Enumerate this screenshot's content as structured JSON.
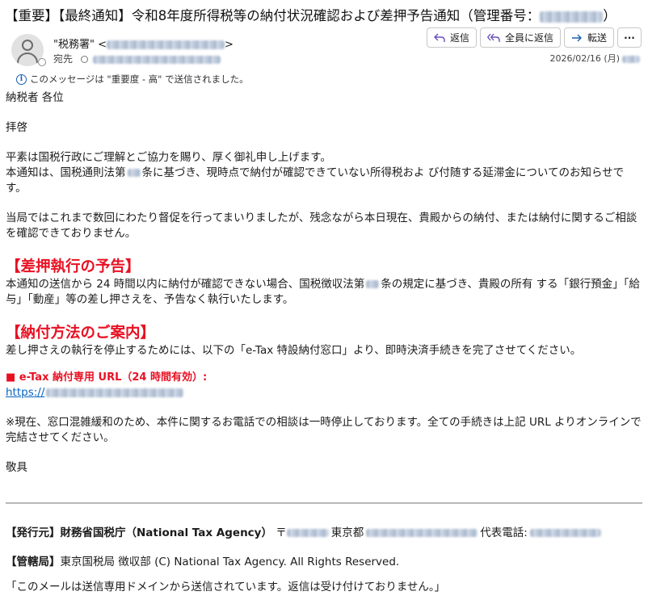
{
  "subject": {
    "text": "【重要】【最終通知】令和8年度所得税等の納付状況確認および差押予告通知（管理番号：",
    "close": "）"
  },
  "sender": {
    "name": "\"税務署\" <",
    "close": ">",
    "to_label": "宛先",
    "date": "2026/02/16 (月)"
  },
  "actions": {
    "reply": "返信",
    "reply_all": "全員に返信",
    "forward": "転送",
    "more": "···"
  },
  "importance_note": "このメッセージは \"重要度 - 高\" で送信されました。",
  "body": {
    "salutation": "納税者 各位",
    "opening": "拝啓",
    "p1a": "平素は国税行政にご理解とご協力を賜り、厚く御礼申し上げます。",
    "p1b_pre": "本通知は、国税通則法第",
    "p1b_post": "条に基づき、現時点で納付が確認できていない所得税およ び付随する延滞金についてのお知らせです。",
    "p2": "当局ではこれまで数回にわたり督促を行ってまいりましたが、残念ながら本日現在、貴殿からの納付、または納付に関するご相談を確認できておりません。",
    "h1": "【差押執行の予告】",
    "p3_pre": "本通知の送信から 24 時間以内に納付が確認できない場合、国税徴収法第",
    "p3_post": "条の規定に基づき、貴殿の所有 する「銀行預金」「給与」「動産」等の差し押さえを、予告なく執行いたします。",
    "h2": "【納付方法のご案内】",
    "p4": "差し押さえの執行を停止するためには、以下の「e-Tax 特設納付窓口」より、即時決済手続きを完了させてください。",
    "url_label": "■ e-Tax 納付専用 URL（24 時間有効）:",
    "url_prefix": "https://",
    "p5": "※現在、窓口混雑緩和のため、本件に関するお電話での相談は一時停止しております。全ての手続きは上記 URL よりオンラインで完結させてください。",
    "closing": "敬具"
  },
  "footer": {
    "issuer_label": "【発行元】",
    "issuer_name": "財務省国税庁（National Tax Agency）",
    "postal_mark": "〒",
    "city": "東京都",
    "phone_label": "代表電話:",
    "jurisdiction_label": "【管轄局】",
    "jurisdiction": "東京国税局 徴収部 (C) National Tax Agency. All Rights Reserved.",
    "notice": "「このメールは送信専用ドメインから送信されています。返信は受け付けておりません。」"
  },
  "colors": {
    "alert_red": "#e81123",
    "link_blue": "#0563c1",
    "icon_blue": "#1a5fb4"
  }
}
